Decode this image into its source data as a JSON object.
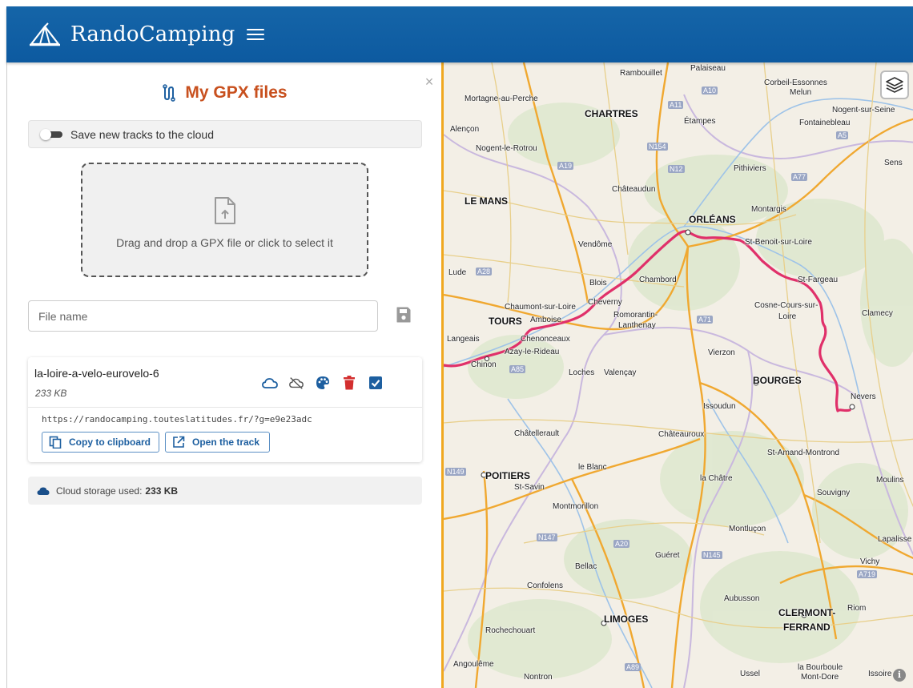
{
  "app": {
    "name": "RandoCamping",
    "colors": {
      "header": "#1565a8",
      "accent": "#c8501e",
      "link": "#1d5fa0",
      "route": "#e0306a",
      "delete": "#d32f2f"
    }
  },
  "sidebar": {
    "title": "My GPX files",
    "cloud_toggle_label": "Save new tracks to the cloud",
    "dropzone_text": "Drag and drop a GPX file or click to select it",
    "filename_placeholder": "File name",
    "tracks": [
      {
        "name": "la-loire-a-velo-eurovelo-6",
        "size": "233 KB",
        "url": "https://randocamping.touteslatitudes.fr/?g=e9e23adc",
        "copy_label": "Copy to clipboard",
        "open_label": "Open the track"
      }
    ],
    "cloud_storage_label": "Cloud storage used:",
    "cloud_storage_value": "233 KB"
  },
  "map": {
    "places": [
      "Rambouillet",
      "Palaiseau",
      "Corbeil-Essonnes",
      "Melun",
      "Nogent-sur-Seine",
      "Fontainebleau",
      "Mortagne-au-Perche",
      "CHARTRES",
      "Étampes",
      "Alençon",
      "Nogent-le-Rotrou",
      "Pithiviers",
      "Sens",
      "Châteaudun",
      "LE MANS",
      "ORLÉANS",
      "Montargis",
      "St-Benoit-sur-Loire",
      "Vendôme",
      "Lude",
      "Blois",
      "Chambord",
      "St-Fargeau",
      "Chaumont-sur-Loire",
      "Cheverny",
      "Cosne-Cours-sur-",
      "Loire",
      "TOURS",
      "Amboise",
      "Romorantin-",
      "Lanthenay",
      "Clamecy",
      "Langeais",
      "Chenonceaux",
      "Azay-le-Rideau",
      "Vierzon",
      "Chinon",
      "Loches",
      "Valençay",
      "BOURGES",
      "Nevers",
      "Issoudun",
      "Châtellerault",
      "Châteauroux",
      "St-Amand-Montrond",
      "POITIERS",
      "le Blanc",
      "la Châtre",
      "Moulins",
      "St-Savin",
      "Souvigny",
      "Montmorillon",
      "Montluçon",
      "Lapalisse",
      "Vichy",
      "Guéret",
      "Bellac",
      "Confolens",
      "Aubusson",
      "LIMOGES",
      "CLERMONT-",
      "FERRAND",
      "Riom",
      "Rochechouart",
      "Angoulême",
      "Nontron",
      "Ussel",
      "la Bourboule",
      "Mont-Dore",
      "Issoire"
    ],
    "highways": [
      "A10",
      "A11",
      "A5",
      "N154",
      "N12",
      "A19",
      "A77",
      "A28",
      "A85",
      "A20",
      "A71",
      "N149",
      "N147",
      "N145",
      "A89",
      "A719"
    ]
  }
}
